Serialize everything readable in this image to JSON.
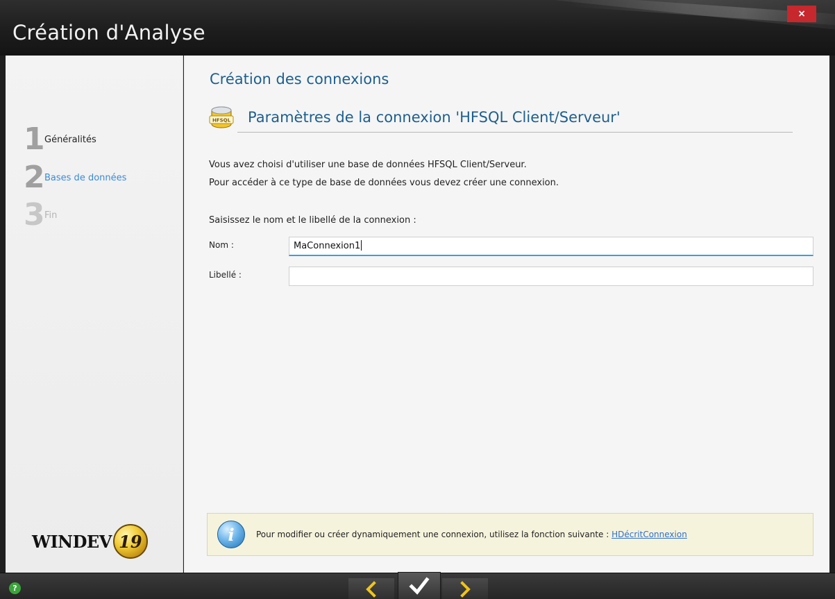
{
  "window": {
    "title": "Création d'Analyse",
    "close_label": "×"
  },
  "steps": [
    {
      "number": "1",
      "label": "Généralités",
      "state": "done"
    },
    {
      "number": "2",
      "label": "Bases de données",
      "state": "active"
    },
    {
      "number": "3",
      "label": "Fin",
      "state": "pending"
    }
  ],
  "logo": {
    "text": "WINDEV",
    "version": "19"
  },
  "main": {
    "section_title": "Création des connexions",
    "subtitle": "Paramètres de la connexion 'HFSQL Client/Serveur'",
    "db_icon_text": "HFSQL",
    "description_line1": "Vous avez choisi d'utiliser une base de données HFSQL Client/Serveur.",
    "description_line2": "Pour accéder à ce type de base de données vous devez créer une connexion.",
    "prompt": "Saisissez le nom et le libellé de la connexion :",
    "fields": {
      "nom_label": "Nom :",
      "nom_value": "MaConnexion1",
      "libelle_label": "Libellé :",
      "libelle_value": ""
    },
    "info": {
      "text": "Pour modifier ou créer dynamiquement une connexion, utilisez la fonction suivante : ",
      "link": "HDécritConnexion"
    }
  },
  "bottom": {
    "help_label": "?",
    "prev_icon": "chevron-left-icon",
    "finish_icon": "checkmark-icon",
    "next_icon": "chevron-right-icon"
  },
  "colors": {
    "accent_blue": "#1d5f8e",
    "active_step": "#3a8bd6",
    "close_red": "#c6282d",
    "nav_arrow_yellow": "#f0c419",
    "info_bg": "#f6f3dc",
    "help_green": "#3aa63a"
  }
}
